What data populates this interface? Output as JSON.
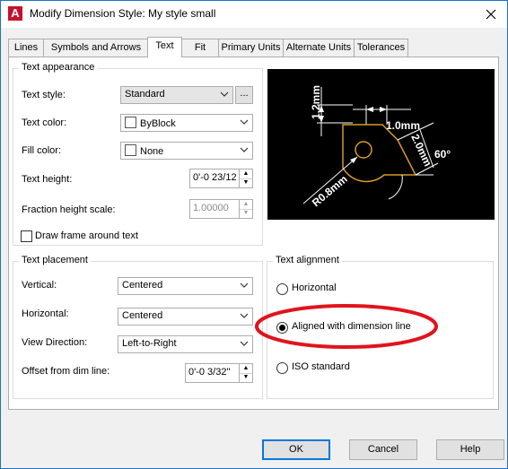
{
  "window": {
    "title": "Modify Dimension Style: My style small",
    "app_icon_letter": "A"
  },
  "tabs": [
    {
      "label": "Lines"
    },
    {
      "label": "Symbols and Arrows"
    },
    {
      "label": "Text"
    },
    {
      "label": "Fit"
    },
    {
      "label": "Primary Units"
    },
    {
      "label": "Alternate Units"
    },
    {
      "label": "Tolerances"
    }
  ],
  "active_tab": "Text",
  "text_appearance": {
    "title": "Text appearance",
    "text_style": {
      "label": "Text style:",
      "value": "Standard",
      "more": "..."
    },
    "text_color": {
      "label": "Text color:",
      "value": "ByBlock"
    },
    "fill_color": {
      "label": "Fill color:",
      "value": "None"
    },
    "text_height": {
      "label": "Text height:",
      "value": "0'-0 23/12"
    },
    "fraction_height_scale": {
      "label": "Fraction height scale:",
      "value": "1.00000"
    },
    "draw_frame": {
      "label": "Draw frame around text",
      "checked": false
    }
  },
  "preview": {
    "dim_top": "1.2mm",
    "dim_right": "1.0mm",
    "dim_angle": "2.0mm",
    "dim_angle2": "60°",
    "dim_radius": "R0.8mm"
  },
  "text_placement": {
    "title": "Text placement",
    "vertical": {
      "label": "Vertical:",
      "value": "Centered"
    },
    "horizontal": {
      "label": "Horizontal:",
      "value": "Centered"
    },
    "view_direction": {
      "label": "View Direction:",
      "value": "Left-to-Right"
    },
    "offset": {
      "label": "Offset from dim line:",
      "value": "0'-0 3/32\""
    }
  },
  "text_alignment": {
    "title": "Text alignment",
    "options": [
      {
        "label": "Horizontal",
        "selected": false
      },
      {
        "label": "Aligned with dimension line",
        "selected": true
      },
      {
        "label": "ISO standard",
        "selected": false
      }
    ],
    "highlight_color": "#e0141e"
  },
  "buttons": {
    "ok": "OK",
    "cancel": "Cancel",
    "help": "Help"
  }
}
